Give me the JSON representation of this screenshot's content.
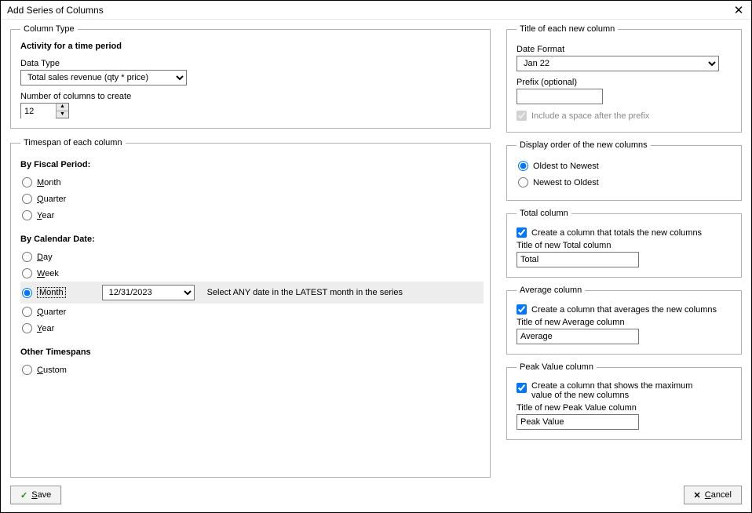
{
  "window": {
    "title": "Add Series of Columns"
  },
  "columnType": {
    "legend": "Column Type",
    "activity": "Activity for a time period",
    "dataTypeLabel": "Data Type",
    "dataTypeValue": "Total sales revenue (qty * price)",
    "numColsLabel": "Number of columns to create",
    "numColsValue": "12"
  },
  "timespan": {
    "legend": "Timespan of each column",
    "byFiscal": "By Fiscal Period:",
    "fiscal": {
      "month": "Month",
      "quarter": "Quarter",
      "year": "Year"
    },
    "byCalendar": "By Calendar Date:",
    "calendar": {
      "day": "Day",
      "week": "Week",
      "month": "Month",
      "monthDate": "12/31/2023",
      "monthHint": "Select ANY date in the LATEST month in the series",
      "quarter": "Quarter",
      "year": "Year"
    },
    "other": "Other Timespans",
    "custom": "Custom"
  },
  "titleCol": {
    "legend": "Title of each new column",
    "dateFormatLabel": "Date Format",
    "dateFormatValue": "Jan 22",
    "prefixLabel": "Prefix (optional)",
    "prefixValue": "",
    "includeSpace": "Include a space after the prefix"
  },
  "displayOrder": {
    "legend": "Display order of the new columns",
    "oldest": "Oldest to Newest",
    "newest": "Newest to Oldest"
  },
  "totalCol": {
    "legend": "Total column",
    "check": "Create a column that totals the new columns",
    "titleLabel": "Title of new Total column",
    "titleValue": "Total"
  },
  "avgCol": {
    "legend": "Average column",
    "check": "Create a column that averages the new columns",
    "titleLabel": "Title of new Average column",
    "titleValue": "Average"
  },
  "peakCol": {
    "legend": "Peak Value column",
    "check": "Create a column that shows the maximum value of the new columns",
    "titleLabel": "Title of new Peak Value column",
    "titleValue": "Peak Value"
  },
  "buttons": {
    "save": "Save",
    "cancel": "Cancel"
  }
}
